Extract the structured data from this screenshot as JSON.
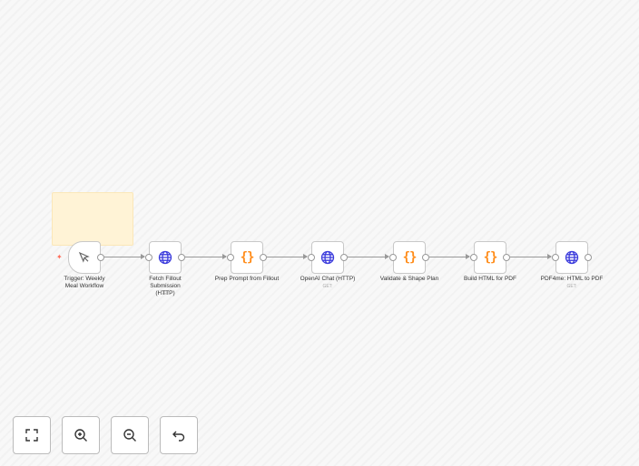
{
  "canvas": {
    "nodes": [
      {
        "name": "Trigger: Weekly Meal Workflow",
        "icon": "pointer-icon",
        "sub": ""
      },
      {
        "name": "Fetch Fillout Submission (HTTP)",
        "icon": "globe-icon",
        "sub": "GET:"
      },
      {
        "name": "Prep Prompt from Fillout",
        "icon": "code-icon",
        "sub": ""
      },
      {
        "name": "OpenAI Chat (HTTP)",
        "icon": "globe-icon",
        "sub": "GET:"
      },
      {
        "name": "Validate & Shape Plan",
        "icon": "code-icon",
        "sub": ""
      },
      {
        "name": "Build HTML for PDF",
        "icon": "code-icon",
        "sub": ""
      },
      {
        "name": "PDF4me: HTML to PDF",
        "icon": "globe-icon",
        "sub": "GET:"
      }
    ],
    "colors": {
      "http": "#3b3bdc",
      "code": "#ff8c1a",
      "trigger_bolt": "#ff6d5a",
      "sticky": "#fff3d6"
    }
  },
  "controls": [
    {
      "name": "fit-view-button",
      "icon": "fullscreen-icon"
    },
    {
      "name": "zoom-in-button",
      "icon": "zoom-in-icon"
    },
    {
      "name": "zoom-out-button",
      "icon": "zoom-out-icon"
    },
    {
      "name": "undo-button",
      "icon": "undo-icon"
    }
  ]
}
